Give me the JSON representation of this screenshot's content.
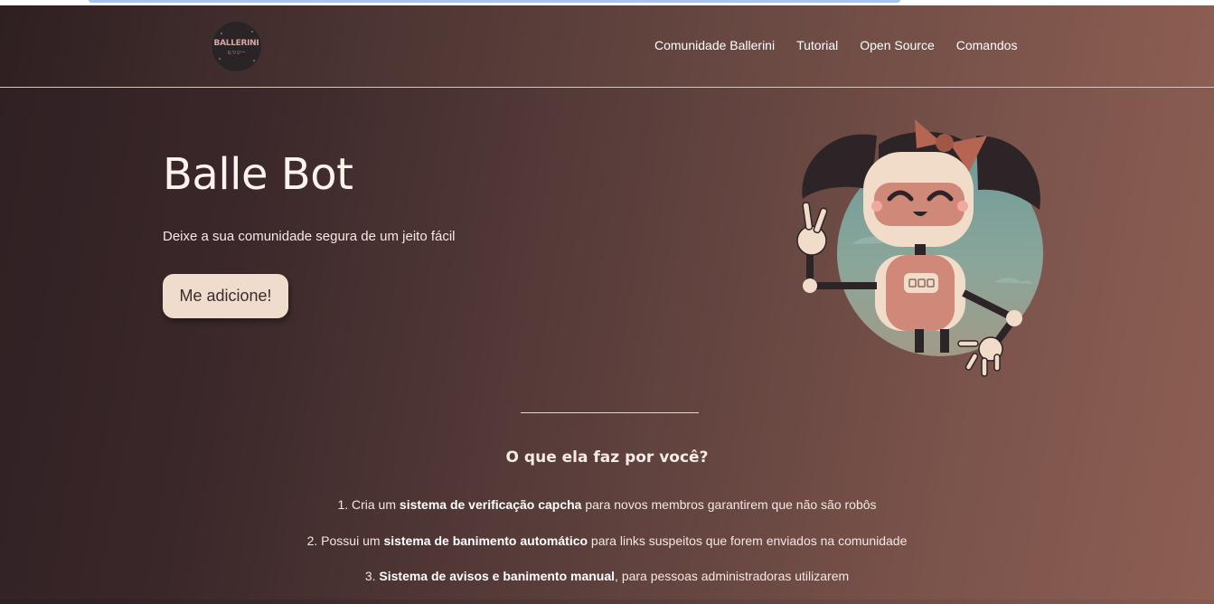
{
  "logo": {
    "text": "BALLERINI",
    "subtext": "ヒツジー"
  },
  "nav": [
    {
      "label": "Comunidade Ballerini"
    },
    {
      "label": "Tutorial"
    },
    {
      "label": "Open Source"
    },
    {
      "label": "Comandos"
    }
  ],
  "hero": {
    "title": "Balle Bot",
    "subtitle": "Deixe a sua comunidade segura de um jeito fácil",
    "cta_label": "Me adicione!"
  },
  "robot_illustration": {
    "icon": "robot-girl-mascot-icon"
  },
  "features": {
    "title": "O que ela faz por você?",
    "items": [
      {
        "prefix": "1. Cria um ",
        "bold": "sistema de verificação capcha",
        "suffix": " para novos membros garantirem que não são robôs"
      },
      {
        "prefix": "2. Possui um ",
        "bold": "sistema de banimento automático",
        "suffix": " para links suspeitos que forem enviados na comunidade"
      },
      {
        "prefix": "3. ",
        "bold": "Sistema de avisos e banimento manual",
        "suffix": ", para pessoas administradoras utilizarem"
      }
    ]
  },
  "colors": {
    "background_dark": "#2f2023",
    "background_light": "#8e5f53",
    "button_bg": "#efdccd",
    "button_text": "#3b2b2b",
    "robot_body": "#f0dcc8",
    "robot_accent": "#d08878"
  }
}
